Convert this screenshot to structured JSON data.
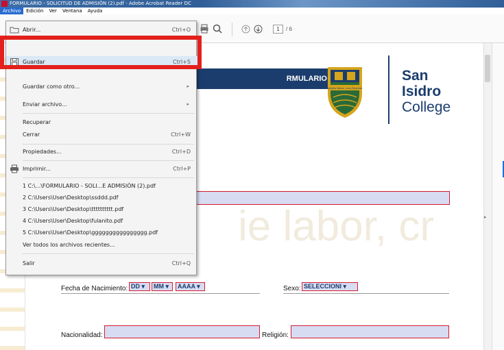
{
  "window": {
    "title": "FORMULARIO - SOLICITUD DE ADMISIÓN (2).pdf - Adobe Acrobat Reader DC"
  },
  "menubar": {
    "items": [
      "Archivo",
      "Edición",
      "Ver",
      "Ventana",
      "Ayuda"
    ]
  },
  "toolbar": {
    "page_current": "1",
    "page_total": "/ 6"
  },
  "file_menu": {
    "open": {
      "label": "Abrir...",
      "shortcut": "Ctrl+O"
    },
    "save": {
      "label": "Guardar",
      "shortcut": "Ctrl+S"
    },
    "save_as": {
      "label": "Guardar como otro..."
    },
    "send": {
      "label": "Enviar archivo..."
    },
    "recover": {
      "label": "Recuperar"
    },
    "close": {
      "label": "Cerrar",
      "shortcut": "Ctrl+W"
    },
    "properties": {
      "label": "Propiedades...",
      "shortcut": "Ctrl+D"
    },
    "print": {
      "label": "Imprimir...",
      "shortcut": "Ctrl+P"
    },
    "recent": [
      "1 C:\\...\\FORMULARIO - SOLI...E ADMISIÓN (2).pdf",
      "2 C:\\Users\\User\\Desktop\\ssddd.pdf",
      "3 C:\\Users\\User\\Desktop\\tttttttttt.pdf",
      "4 C:\\Users\\User\\Desktop\\fulanito.pdf",
      "5 C:\\Users\\User\\Desktop\\gggggggggggggggg.pdf"
    ],
    "view_all": {
      "label": "Ver todos los archivos recientes..."
    },
    "exit": {
      "label": "Salir",
      "shortcut": "Ctrl+Q"
    }
  },
  "document": {
    "form_title": "RMULARIO",
    "brand": {
      "line1": "San",
      "line2": "Isidro",
      "line3": "College"
    },
    "crest_motto": "studio labor, cras fructus",
    "watermark": "ie labor, cr",
    "birth_label": "Fecha de Nacimiento:",
    "day": "DD",
    "month": "MM",
    "year": "AAAA",
    "sex_label": "Sexo:",
    "sex_value": "SELECCIONI",
    "nationality_label": "Nacionalidad:",
    "religion_label": "Religión:"
  },
  "colors": {
    "accent": "#2a6bd1",
    "highlight": "#e3201c",
    "navy": "#1b3d6d",
    "field_border": "#d21c2e",
    "field_fill": "#d8dcf3"
  }
}
